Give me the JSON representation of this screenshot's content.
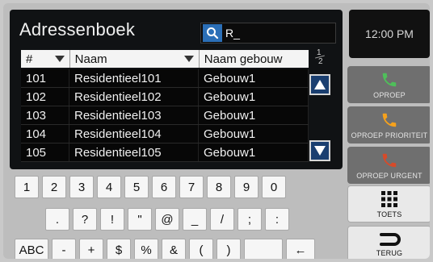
{
  "header": {
    "title": "Adressenboek",
    "time": "12:00 PM"
  },
  "search": {
    "value": "R_"
  },
  "table": {
    "columns": [
      "#",
      "Naam",
      "Naam gebouw"
    ],
    "rows": [
      {
        "num": "101",
        "name": "Residentieel101",
        "building": "Gebouw1"
      },
      {
        "num": "102",
        "name": "Residentieel102",
        "building": "Gebouw1"
      },
      {
        "num": "103",
        "name": "Residentieel103",
        "building": "Gebouw1"
      },
      {
        "num": "104",
        "name": "Residentieel104",
        "building": "Gebouw1"
      },
      {
        "num": "105",
        "name": "Residentieel105",
        "building": "Gebouw1"
      }
    ]
  },
  "pager": {
    "current": "1",
    "total": "2"
  },
  "side": {
    "oproep": "OPROEP",
    "oproep_prioriteit": "OPROEP PRIORITEIT",
    "oproep_urgent": "OPROEP URGENT",
    "toets": "TOETS",
    "terug": "TERUG"
  },
  "keyboard": {
    "row1": [
      "1",
      "2",
      "3",
      "4",
      "5",
      "6",
      "7",
      "8",
      "9",
      "0"
    ],
    "row2": [
      ".",
      "?",
      "!",
      "\"",
      "@",
      "_",
      "/",
      ";",
      ":"
    ],
    "row3": [
      "ABC",
      "-",
      "+",
      "$",
      "%",
      "&",
      "(",
      ")",
      "",
      "←"
    ]
  },
  "colors": {
    "accent_blue": "#1b3f70",
    "call_green": "#4fbf5a",
    "call_orange": "#f5a11c",
    "call_red": "#d64b2a"
  }
}
